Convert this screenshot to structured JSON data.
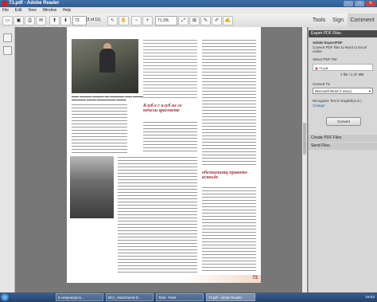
{
  "window": {
    "title": "73.pdf - Adobe Reader",
    "min": "–",
    "max": "□",
    "close": "✕"
  },
  "menu": [
    "File",
    "Edit",
    "View",
    "Window",
    "Help"
  ],
  "toolbar": {
    "page_current": "73",
    "page_total": "(3 of 11)",
    "zoom": "71,3%"
  },
  "right_tabs": [
    "Tools",
    "Sign",
    "Comment"
  ],
  "right_panel": {
    "export_header": "Export PDF Files",
    "service_name": "Adobe ExportPDF",
    "description": "Convert PDF files to Word or Excel online.",
    "select_label": "Select PDF File:",
    "file_name": "73.pdf",
    "file_info": "1 file / 2.37 MB",
    "convert_to_label": "Convert To:",
    "convert_to_value": "Microsoft Word (*.docx)",
    "recognize_text": "Recognize Text in English(U.S.)",
    "change_link": "Change",
    "convert_button": "Convert",
    "create_header": "Create PDF Files",
    "send_header": "Send Files"
  },
  "document": {
    "heading1": "Клуб е с клуб не се печели враговете",
    "heading2": "обезпамиящ правото всякъде",
    "page_number": "73"
  },
  "taskbar": {
    "items": [
      "Е-непроигралн...",
      "ВСУ_Attachments D...",
      "Total - Paint",
      "73.pdf - Adobe Reader"
    ],
    "clock": "16:52"
  }
}
